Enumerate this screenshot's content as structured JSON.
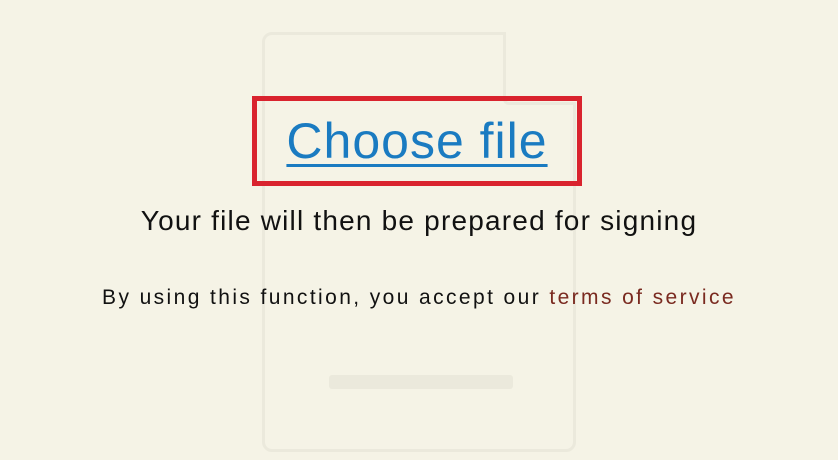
{
  "upload": {
    "choose_file_label": "Choose file",
    "info_text": "Your file will then be prepared for signing"
  },
  "terms": {
    "prefix": "By using this function, you accept our ",
    "link_label": "terms of service"
  },
  "colors": {
    "background": "#f5f3e6",
    "link": "#1a7bc1",
    "highlight_border": "#d9232e",
    "terms_link": "#7a2a20"
  },
  "icons": {
    "background_icon": "document-icon"
  }
}
